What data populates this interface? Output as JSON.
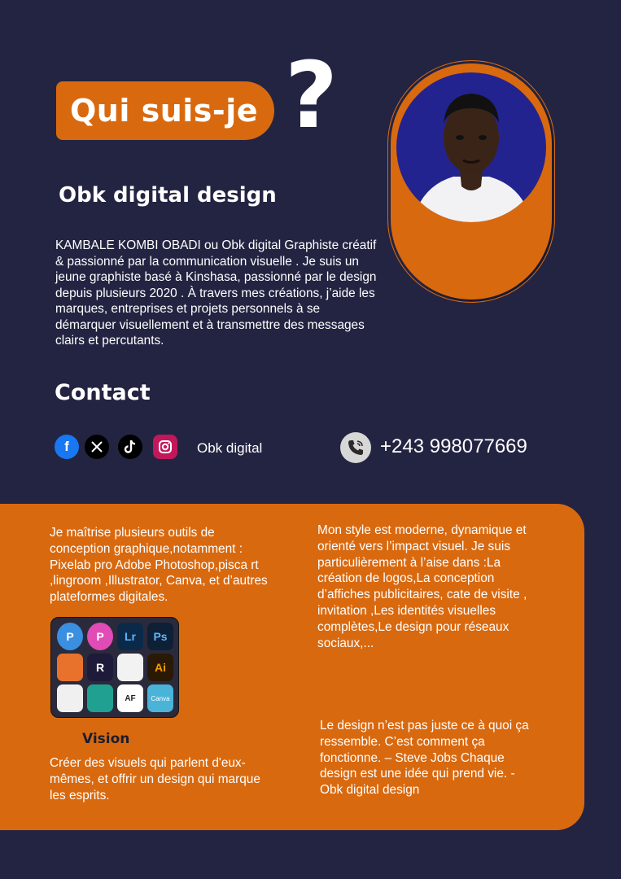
{
  "header": {
    "title": "Qui suis-je",
    "question_mark": "?"
  },
  "about": {
    "brand": "Obk digital design",
    "bio": "KAMBALE KOMBI OBADI  ou Obk digital  Graphiste créatif & passionné par la communication visuelle . Je suis un jeune graphiste basé à Kinshasa, passionné par le design depuis plusieurs 2020 . À travers mes créations, j’aide les marques, entreprises et projets personnels à se démarquer visuellement et à transmettre des messages clairs et percutants."
  },
  "contact": {
    "heading": "Contact",
    "social_icons": [
      "facebook-icon",
      "x-icon",
      "tiktok-icon",
      "instagram-icon"
    ],
    "social_handle": "Obk digital",
    "phone": "+243 998077669"
  },
  "skills": {
    "tools": "Je maîtrise plusieurs outils de conception graphique,notamment : Pixelab pro Adobe Photoshop,pisca rt ,lingroom ,Illustrator, Canva, et d’autres plateformes digitales.",
    "style": "Mon style est moderne, dynamique et orienté vers l’impact visuel. Je suis particulièrement à l’aise dans :La création de logos,La conception d’affiches publicitaires, cate de visite , invitation ,Les identités visuelles complètes,Le design pour réseaux sociaux,...",
    "apps": [
      {
        "icon": "pixellab-icon",
        "label": "P",
        "color": "#3b8fe0"
      },
      {
        "icon": "picsart-icon",
        "label": "P",
        "color": "#e04bb6"
      },
      {
        "icon": "lightroom-icon",
        "label": "Lr",
        "color": "#0b2a4a"
      },
      {
        "icon": "photoshop-icon",
        "label": "Ps",
        "color": "#0d2035"
      },
      {
        "icon": "sketchbook-icon",
        "label": "",
        "color": "#e8722c"
      },
      {
        "icon": "pixellab-r-icon",
        "label": "R",
        "color": "#1e1a3a"
      },
      {
        "icon": "transparent-bg-icon",
        "label": "",
        "color": "#f2f2f2"
      },
      {
        "icon": "illustrator-icon",
        "label": "Ai",
        "color": "#2a1a05"
      },
      {
        "icon": "snapseed-icon",
        "label": "",
        "color": "#f0f0f0"
      },
      {
        "icon": "spiral-app-icon",
        "label": "",
        "color": "#20a090"
      },
      {
        "icon": "aperture-app-icon",
        "label": "AF",
        "color": "#ffffff"
      },
      {
        "icon": "canva-icon",
        "label": "Canva",
        "color": "#4ab3d8"
      }
    ]
  },
  "vision": {
    "heading": "Vision",
    "text": "Créer des visuels qui parlent d'eux-mêmes, et offrir un design qui marque les esprits."
  },
  "quote": {
    "text": "Le design n’est pas juste ce à quoi ça ressemble. C’est comment ça fonctionne. – Steve Jobs Chaque design est une idée qui prend vie. - Obk digital design"
  },
  "colors": {
    "background": "#232442",
    "accent": "#d9690f",
    "portrait_bg": "#23238f"
  }
}
